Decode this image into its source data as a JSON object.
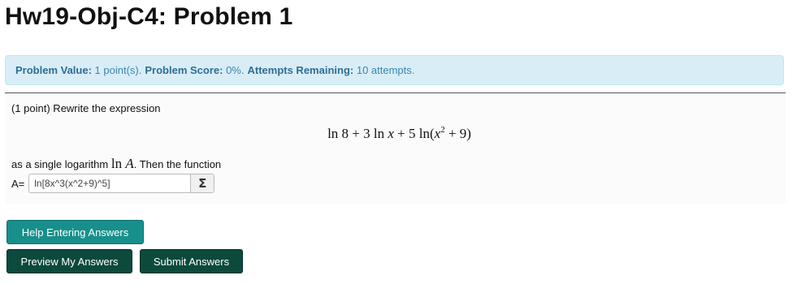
{
  "page": {
    "title": "Hw19-Obj-C4: Problem 1"
  },
  "info": {
    "problem_value_label": "Problem Value:",
    "problem_value": "1 point(s).",
    "problem_score_label": "Problem Score:",
    "problem_score": "0%.",
    "attempts_label": "Attempts Remaining:",
    "attempts": "10 attempts."
  },
  "problem": {
    "intro": "(1 point) Rewrite the expression",
    "expression": {
      "part1": "ln 8 + 3 ln ",
      "var1": "x",
      "part2": " + 5 ln(",
      "var2": "x",
      "exponent": "2",
      "part3": " + 9)"
    },
    "sentence_start": "as a single logarithm ",
    "sentence_ln": "ln ",
    "sentence_var": "A",
    "sentence_end": ". Then the function",
    "answer_label": "A=",
    "answer_value": "ln[8x^3(x^2+9)^5]",
    "equation_editor_icon": "Σ"
  },
  "buttons": {
    "help": "Help Entering Answers",
    "preview": "Preview My Answers",
    "submit": "Submit Answers"
  },
  "colors": {
    "info_bg": "#d9edf7",
    "info_text": "#3a87ad",
    "help_button": "#178f8a",
    "action_buttons": "#0b4a3c"
  }
}
